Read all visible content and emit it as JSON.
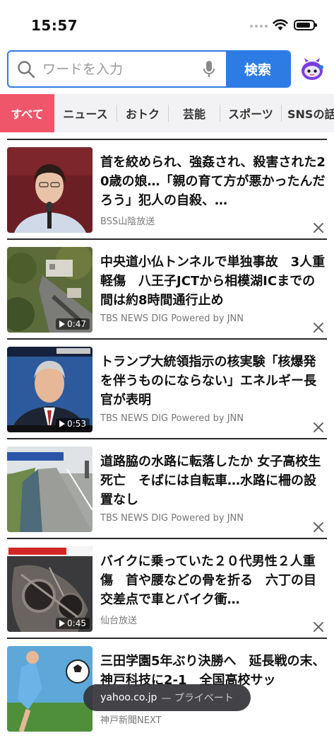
{
  "status": {
    "time": "15:57"
  },
  "search": {
    "placeholder": "ワードを入力",
    "button_label": "検索"
  },
  "tabs": [
    {
      "label": "すべて",
      "active": true
    },
    {
      "label": "ニュース"
    },
    {
      "label": "おトク"
    },
    {
      "label": "芸能"
    },
    {
      "label": "スポーツ"
    },
    {
      "label": "SNSの話"
    }
  ],
  "news": [
    {
      "headline": "首を絞められ、強姦され、殺害された20歳の娘…「親の育て方が悪かったんだろう」犯人の自殺、…",
      "source": "BSS山陰放送",
      "duration": ""
    },
    {
      "headline": "中央道小仏トンネルで単独事故　3人重軽傷　八王子JCTから相模湖ICまでの間は約8時間通行止め",
      "source": "TBS NEWS DIG Powered by JNN",
      "duration": "0:47"
    },
    {
      "headline": "トランプ大統領指示の核実験「核爆発を伴うものにならない」エネルギー長官が表明",
      "source": "TBS NEWS DIG Powered by JNN",
      "duration": "0:53"
    },
    {
      "headline": "道路脇の水路に転落したか 女子高校生死亡　そばには自転車…水路に柵の設置なし",
      "source": "TBS NEWS DIG Powered by JNN",
      "duration": ""
    },
    {
      "headline": "バイクに乗っていた２０代男性２人重傷　首や腰などの骨を折る　六丁の目交差点で車とバイク衝…",
      "source": "仙台放送",
      "duration": "0:45"
    },
    {
      "headline": "三田学園5年ぶり決勝へ　延長戦の末、神戸科技に2-1　全国高校サッ",
      "source": "神戸新聞NEXT",
      "duration": ""
    }
  ],
  "browser": {
    "domain": "yahoo.co.jp",
    "mode": "— プライベート"
  },
  "colors": {
    "accent_blue": "#2d7be5",
    "tab_active": "#f0566a"
  }
}
